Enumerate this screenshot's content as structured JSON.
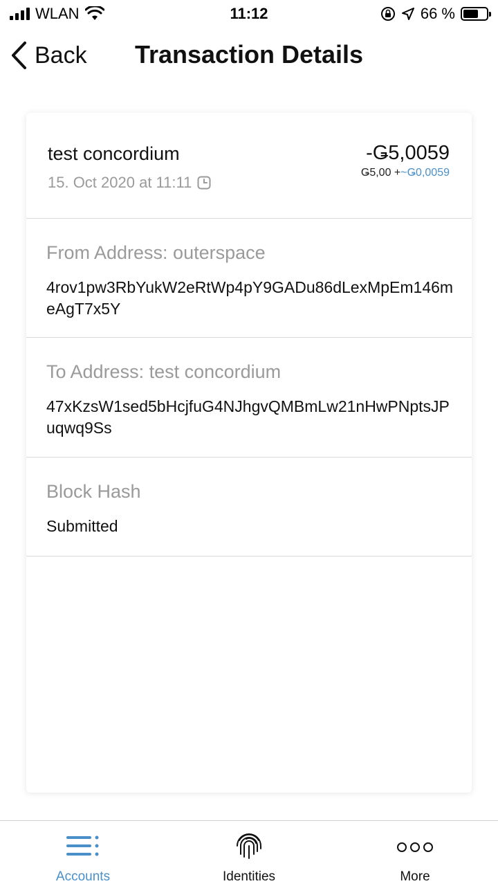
{
  "status_bar": {
    "carrier": "WLAN",
    "time": "11:12",
    "battery_percent": "66 %",
    "battery_level": 0.66
  },
  "nav": {
    "back_label": "Back",
    "title": "Transaction Details"
  },
  "transaction": {
    "name": "test concordium",
    "date": "15. Oct 2020 at 11:11",
    "amount": "-Ǥ5,0059",
    "subtotal": "Ǥ5,00 +",
    "fee": "~Ǥ0,0059"
  },
  "from": {
    "label": "From Address: outerspace",
    "address": "4rov1pw3RbYukW2eRtWp4pY9GADu86dLexMpEm146meAgT7x5Y"
  },
  "to": {
    "label": "To Address: test concordium",
    "address": "47xKzsW1sed5bHcjfuG4NJhgvQMBmLw21nHwPNptsJPuqwq9Ss"
  },
  "block": {
    "label": "Block Hash",
    "value": "Submitted"
  },
  "tabs": [
    {
      "label": "Accounts",
      "icon": "accounts-icon",
      "active": true
    },
    {
      "label": "Identities",
      "icon": "fingerprint-icon",
      "active": false
    },
    {
      "label": "More",
      "icon": "more-icon",
      "active": false
    }
  ],
  "colors": {
    "accent": "#4a8fc7",
    "muted_text": "#9a9a9a",
    "divider": "#d9d9d9"
  }
}
